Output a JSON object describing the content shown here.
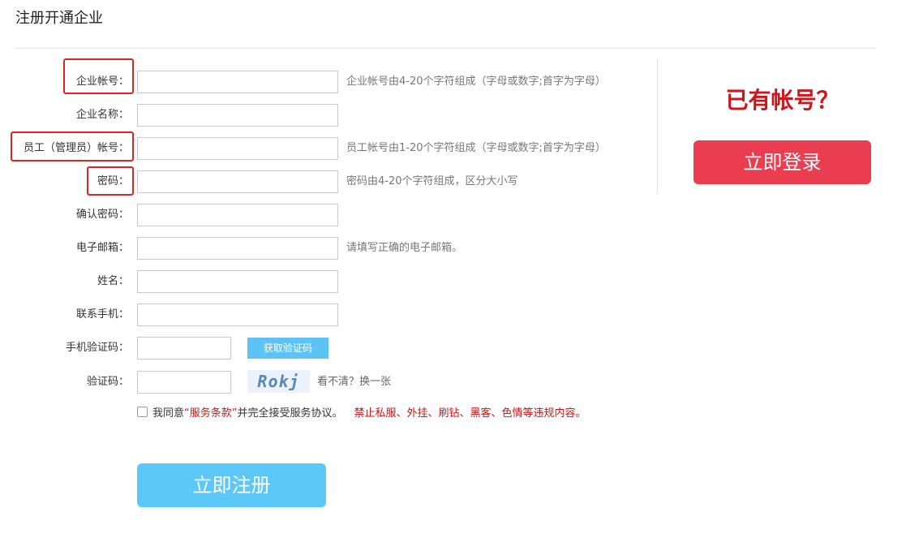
{
  "page": {
    "title": "注册开通企业"
  },
  "form": {
    "fields": [
      {
        "label": "企业帐号：",
        "value": "",
        "hint": "企业帐号由4-20个字符组成（字母或数字;首字为字母）"
      },
      {
        "label": "企业名称：",
        "value": "",
        "hint": ""
      },
      {
        "label": "员工（管理员）帐号：",
        "value": "",
        "hint": "员工帐号由1-20个字符组成（字母或数字;首字为字母）"
      },
      {
        "label": "密码：",
        "value": "",
        "hint": "密码由4-20个字符组成，区分大小写"
      },
      {
        "label": "确认密码：",
        "value": "",
        "hint": ""
      },
      {
        "label": "电子邮箱：",
        "value": "",
        "hint": "请填写正确的电子邮箱。"
      },
      {
        "label": "姓名：",
        "value": "",
        "hint": ""
      },
      {
        "label": "联系手机：",
        "value": "",
        "hint": ""
      },
      {
        "label": "手机验证码：",
        "value": "",
        "hint": ""
      },
      {
        "label": "验证码：",
        "value": "",
        "hint": ""
      }
    ],
    "sms_button": "获取验证码",
    "captcha_text": "Rokj",
    "captcha_refresh": "看不清？换一张",
    "agree": {
      "checked": false,
      "prefix": "我同意",
      "terms": "“服务条款”",
      "suffix": "并完全接受服务协议。",
      "warning": "禁止私服、外挂、刷钻、黑客、色情等违规内容。"
    },
    "submit": "立即注册"
  },
  "sidebar": {
    "have_account": "已有帐号？",
    "login": "立即登录"
  },
  "colors": {
    "highlight_border": "#e02424",
    "register_button": "#5bc8f7",
    "login_button": "#ea3d50",
    "have_account_text": "#d0151b",
    "sms_button": "#5bc4f5"
  }
}
